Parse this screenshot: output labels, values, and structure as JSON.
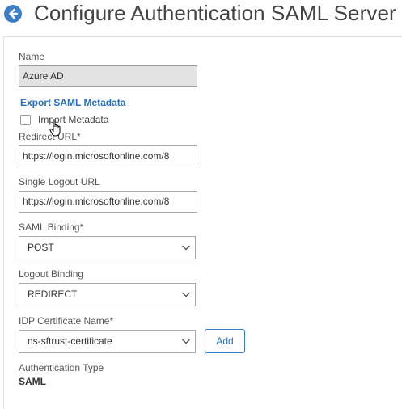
{
  "header": {
    "title": "Configure Authentication SAML Server",
    "back_icon": "arrow-left-circle-icon",
    "accent_color": "#3d7fc7"
  },
  "form": {
    "name_label": "Name",
    "name_value": "Azure AD",
    "export_link": "Export SAML Metadata",
    "import_label": "Import Metadata",
    "import_checked": false,
    "redirect_label": "Redirect URL*",
    "redirect_value": "https://login.microsoftonline.com/8",
    "logout_url_label": "Single Logout URL",
    "logout_url_value": "https://login.microsoftonline.com/8",
    "saml_binding_label": "SAML Binding*",
    "saml_binding_value": "POST",
    "logout_binding_label": "Logout Binding",
    "logout_binding_value": "REDIRECT",
    "idp_cert_label": "IDP Certificate Name*",
    "idp_cert_value": "ns-sftrust-certificate",
    "add_label": "Add",
    "auth_type_label": "Authentication Type",
    "auth_type_value": "SAML"
  }
}
